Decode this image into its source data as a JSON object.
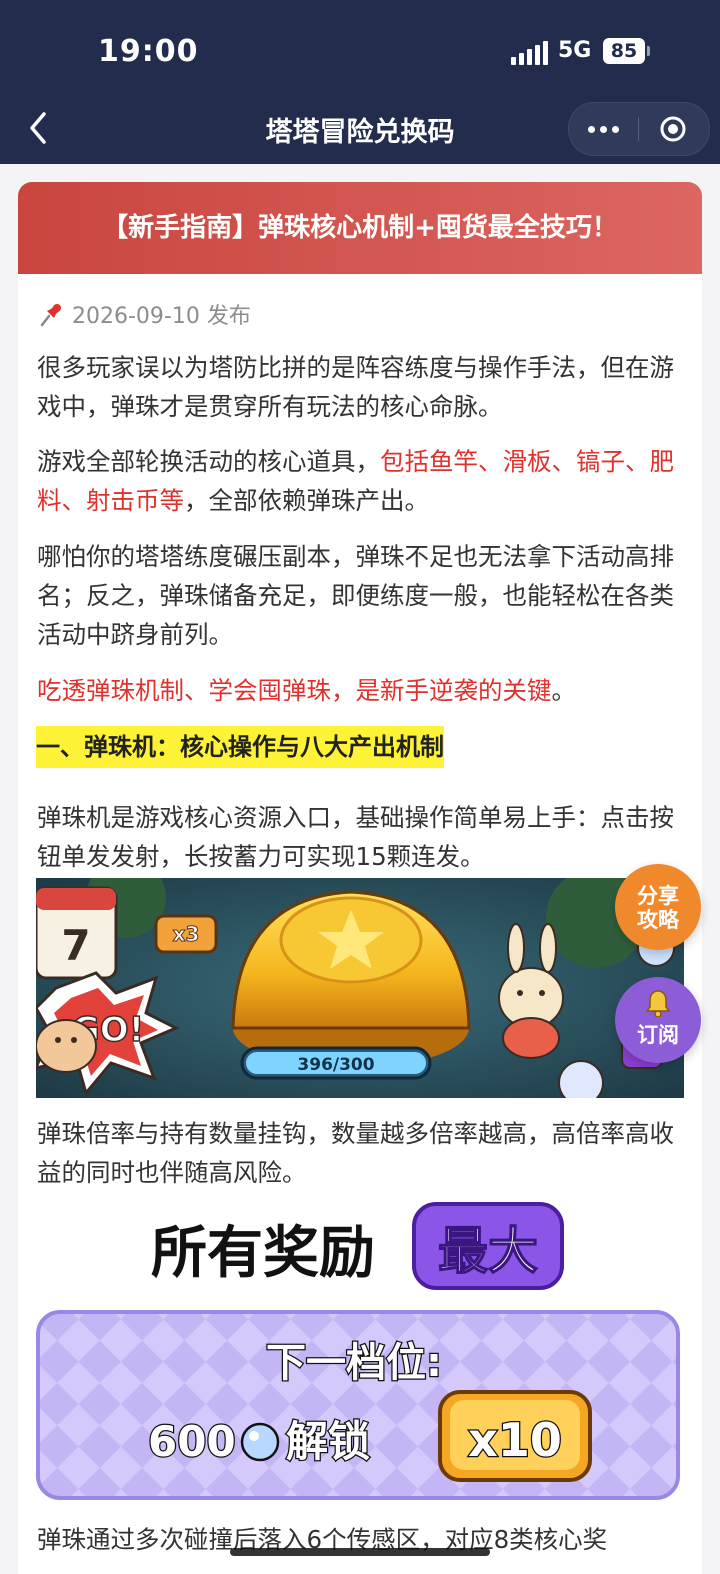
{
  "status": {
    "time": "19:00",
    "network": "5G",
    "battery": "85"
  },
  "nav": {
    "title": "塔塔冒险兑换码"
  },
  "article": {
    "banner_title": "【新手指南】弹珠核心机制+囤货最全技巧！",
    "date": "2026-09-10 发布",
    "p1": "很多玩家误以为塔防比拼的是阵容练度与操作手法，但在游戏中，弹珠才是贯穿所有玩法的核心命脉。",
    "p2_a": "游戏全部轮换活动的核心道具，",
    "p2_red": "包括鱼竿、滑板、镐子、肥料、射击币等",
    "p2_b": "，全部依赖弹珠产出。",
    "p3": "哪怕你的塔塔练度碾压副本，弹珠不足也无法拿下活动高排名；反之，弹珠储备充足，即便练度一般，也能轻松在各类活动中跻身前列。",
    "p4_red": "吃透弹珠机制、学会囤弹珠，是新手逆袭的关键",
    "p4_end": "。",
    "section1": "一、弹珠机：核心操作与八大产出机制",
    "p5": "弹珠机是游戏核心资源入口，基础操作简单易上手：点击按钮单发发射，长按蓄力可实现15颗连发。",
    "p6": "弹珠倍率与持有数量挂钩，数量越多倍率越高，高倍率高收益的同时也伴随高风险。",
    "p7": "弹珠通过多次碰撞后落入6个传感区，对应8类核心奖"
  },
  "game_image": {
    "multiplier": "x3",
    "go": "GO!",
    "progress": "396/300",
    "calendar_num": "7"
  },
  "reward_image": {
    "all_rewards": "所有奖励",
    "max": "最大",
    "next_tier": "下一档位:",
    "amount": "600",
    "unlock": "解锁",
    "mult": "x10"
  },
  "floating": {
    "share_line1": "分享",
    "share_line2": "攻略",
    "subscribe": "订阅"
  },
  "colors": {
    "nav_bg": "#222c4d",
    "banner_red": "#d0504a",
    "accent_red": "#e0322d",
    "highlight": "#fff338",
    "share_orange": "#f0892c",
    "subscribe_purple": "#8d5dd8"
  }
}
